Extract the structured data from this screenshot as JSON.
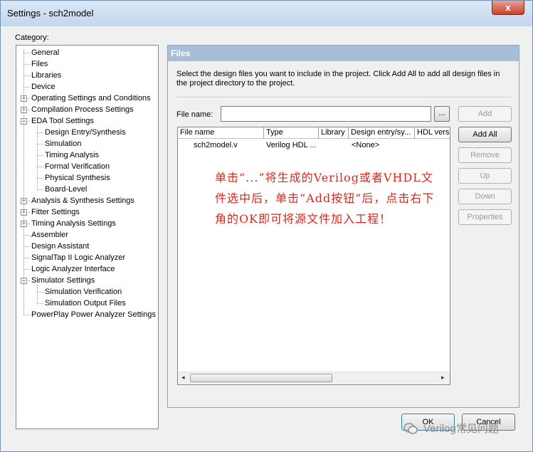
{
  "window": {
    "title": "Settings - sch2model",
    "close_label": "x"
  },
  "category": {
    "label": "Category:",
    "items": [
      {
        "label": "General",
        "level": 0,
        "expander": ""
      },
      {
        "label": "Files",
        "level": 0,
        "expander": ""
      },
      {
        "label": "Libraries",
        "level": 0,
        "expander": ""
      },
      {
        "label": "Device",
        "level": 0,
        "expander": ""
      },
      {
        "label": "Operating Settings and Conditions",
        "level": 0,
        "expander": "+"
      },
      {
        "label": "Compilation Process Settings",
        "level": 0,
        "expander": "+"
      },
      {
        "label": "EDA Tool Settings",
        "level": 0,
        "expander": "−"
      },
      {
        "label": "Design Entry/Synthesis",
        "level": 1,
        "expander": ""
      },
      {
        "label": "Simulation",
        "level": 1,
        "expander": ""
      },
      {
        "label": "Timing Analysis",
        "level": 1,
        "expander": ""
      },
      {
        "label": "Formal Verification",
        "level": 1,
        "expander": ""
      },
      {
        "label": "Physical Synthesis",
        "level": 1,
        "expander": ""
      },
      {
        "label": "Board-Level",
        "level": 1,
        "expander": ""
      },
      {
        "label": "Analysis & Synthesis Settings",
        "level": 0,
        "expander": "+"
      },
      {
        "label": "Fitter Settings",
        "level": 0,
        "expander": "+"
      },
      {
        "label": "Timing Analysis Settings",
        "level": 0,
        "expander": "+"
      },
      {
        "label": "Assembler",
        "level": 0,
        "expander": ""
      },
      {
        "label": "Design Assistant",
        "level": 0,
        "expander": ""
      },
      {
        "label": "SignalTap II Logic Analyzer",
        "level": 0,
        "expander": ""
      },
      {
        "label": "Logic Analyzer Interface",
        "level": 0,
        "expander": ""
      },
      {
        "label": "Simulator Settings",
        "level": 0,
        "expander": "−"
      },
      {
        "label": "Simulation Verification",
        "level": 1,
        "expander": ""
      },
      {
        "label": "Simulation Output Files",
        "level": 1,
        "expander": ""
      },
      {
        "label": "PowerPlay Power Analyzer Settings",
        "level": 0,
        "expander": ""
      }
    ]
  },
  "files_panel": {
    "header": "Files",
    "description": "Select the design files you want to include in the project. Click Add All to add all design files in the project directory to the project.",
    "file_name_label": "File name:",
    "file_name_value": "",
    "browse_label": "...",
    "buttons": {
      "add": "Add",
      "add_all": "Add All",
      "remove": "Remove",
      "up": "Up",
      "down": "Down",
      "properties": "Properties"
    },
    "columns": [
      "File name",
      "Type",
      "Library",
      "Design entry/sy...",
      "HDL vers"
    ],
    "rows": [
      {
        "file_name": "sch2model.v",
        "type": "Verilog HDL ...",
        "library": "",
        "design_entry": "<None>",
        "hdl_version": ""
      }
    ],
    "scroll_left": "◂",
    "scroll_right": "▸"
  },
  "annotation": {
    "text": "单击“...”将生成的Verilog或者VHDL文件选中后，单击“Add按钮”后，点击右下角的OK即可将源文件加入工程！"
  },
  "footer": {
    "ok": "OK",
    "cancel": "Cancel"
  },
  "watermark": {
    "text": "Verilog常见问题"
  }
}
